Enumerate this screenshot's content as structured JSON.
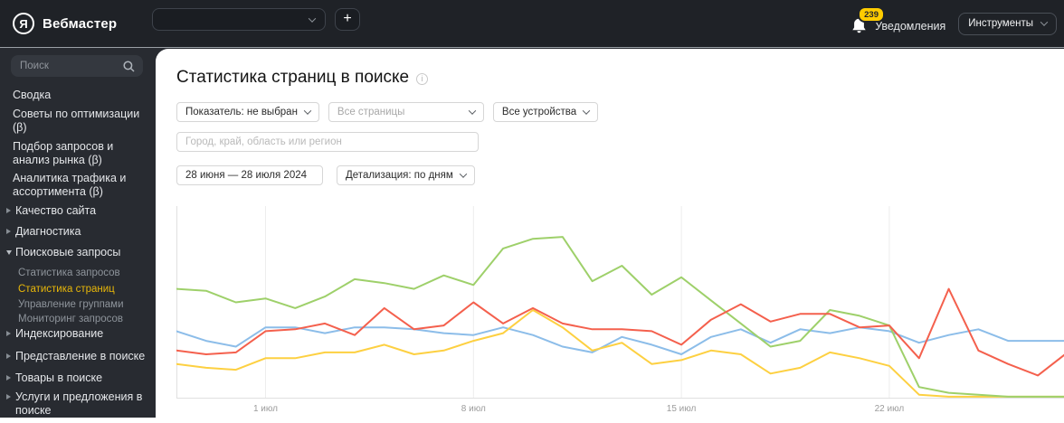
{
  "topbar": {
    "brand": "Вебмастер",
    "logo_letter": "Я",
    "site_select_value": "",
    "add_label": "+",
    "notifications_count": "239",
    "notifications_label": "Уведомления",
    "tools_label": "Инструменты"
  },
  "colors": {
    "topbar_bg": "#1f2227",
    "sidebar_bg": "#282b31",
    "badge_bg": "#ffcc00",
    "active_nav_item": "#e8b709"
  },
  "sidebar": {
    "search_placeholder": "Поиск",
    "items": [
      {
        "label": "Сводка",
        "type": "main"
      },
      {
        "label": "Советы по оптимизации (β)",
        "type": "main"
      },
      {
        "label": "Подбор запросов и анализ рынка (β)",
        "type": "main"
      },
      {
        "label": "Аналитика трафика и ассортимента (β)",
        "type": "main"
      },
      {
        "label": "Качество сайта",
        "type": "main",
        "arrow": "collapsed"
      },
      {
        "label": "Диагностика",
        "type": "main",
        "arrow": "collapsed"
      },
      {
        "label": "Поисковые запросы",
        "type": "main",
        "arrow": "expanded"
      },
      {
        "label": "Статистика запросов",
        "type": "sub"
      },
      {
        "label": "Статистика страниц",
        "type": "sub",
        "active": true
      },
      {
        "label": "Управление группами",
        "type": "sub"
      },
      {
        "label": "Мониторинг запросов",
        "type": "sub"
      },
      {
        "label": "Индексирование",
        "type": "main",
        "arrow": "collapsed"
      },
      {
        "label": "Представление в поиске",
        "type": "main",
        "arrow": "collapsed"
      },
      {
        "label": "Товары в поиске",
        "type": "main",
        "arrow": "collapsed"
      },
      {
        "label": "Услуги и предложения в поиске",
        "type": "main",
        "arrow": "collapsed"
      }
    ]
  },
  "main": {
    "title": "Статистика страниц в поиске",
    "filters": {
      "metric": "Показатель: не выбран",
      "pages": "Все страницы",
      "devices": "Все устройства",
      "region_placeholder": "Город, край, область или регион",
      "date_range": "28 июня — 28 июля 2024",
      "detail": "Детализация: по дням"
    }
  },
  "chart_data": {
    "type": "line",
    "title": "",
    "xlabel": "",
    "ylabel": "",
    "x_range": [
      "28 июня 2024",
      "28 июля 2024"
    ],
    "days": 31,
    "ylim": [
      0,
      100
    ],
    "y_units": "percent-of-plot-height (no y axis labels shown)",
    "grid": "vertical-only",
    "legend": "none",
    "grid_color": "#ededed",
    "axis_color": "#e0e0e0",
    "tick_color": "#9b9b9b",
    "ticks": [
      {
        "label": "1 июл",
        "day": 3
      },
      {
        "label": "8 июл",
        "day": 10
      },
      {
        "label": "15 июл",
        "day": 17
      },
      {
        "label": "22 июл",
        "day": 24
      }
    ],
    "series": [
      {
        "name": "blue",
        "color": "#8cbde9",
        "values": [
          35,
          30,
          27,
          37,
          37,
          34,
          37,
          37,
          36,
          34,
          33,
          37,
          33,
          27,
          24,
          32,
          28,
          23,
          32,
          36,
          29,
          36,
          34,
          37,
          35,
          29,
          33,
          36,
          30,
          30,
          30
        ]
      },
      {
        "name": "yellow",
        "color": "#fdd041",
        "values": [
          18,
          16,
          15,
          21,
          21,
          24,
          24,
          28,
          23,
          25,
          30,
          34,
          46,
          37,
          25,
          29,
          18,
          20,
          25,
          23,
          13,
          16,
          24,
          21,
          17,
          2,
          1,
          1,
          1,
          1,
          1
        ]
      },
      {
        "name": "green",
        "color": "#9ed06a",
        "values": [
          57,
          56,
          50,
          52,
          47,
          53,
          62,
          60,
          57,
          64,
          59,
          78,
          83,
          84,
          61,
          69,
          54,
          63,
          51,
          39,
          27,
          30,
          46,
          43,
          38,
          6,
          3,
          2,
          1,
          1,
          1
        ]
      },
      {
        "name": "red",
        "color": "#f4604d",
        "values": [
          25,
          23,
          24,
          35,
          36,
          39,
          33,
          47,
          36,
          38,
          50,
          39,
          47,
          39,
          36,
          36,
          35,
          28,
          41,
          49,
          40,
          44,
          44,
          37,
          38,
          21,
          57,
          25,
          18,
          12,
          24
        ]
      }
    ]
  }
}
